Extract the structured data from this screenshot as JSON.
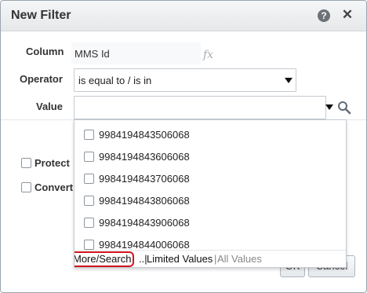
{
  "dialog": {
    "title": "New Filter",
    "help_icon": "question-circle-icon",
    "close_icon": "close-x-icon"
  },
  "form": {
    "column_label": "Column",
    "column_value": "MMS Id",
    "fx_label": "fx",
    "operator_label": "Operator",
    "operator_value": "is equal to / is in",
    "value_label": "Value",
    "value_current": ""
  },
  "options": {
    "protect_label": "Protect",
    "convert_label": "Convert"
  },
  "dropdown": {
    "items": [
      "9984194843506068",
      "9984194843606068",
      "9984194843706068",
      "9984194843806068",
      "9984194843906068",
      "9984194844006068"
    ],
    "footer": {
      "more_search": "More/Search",
      "separator": "..|",
      "limited_values": "Limited Values",
      "pipe": "|",
      "all_values": "All Values"
    }
  },
  "buttons": {
    "ok": "OK",
    "cancel": "Cancel"
  },
  "colors": {
    "highlight": "#d1141d",
    "link": "#1f5fa8",
    "muted": "#888888"
  }
}
